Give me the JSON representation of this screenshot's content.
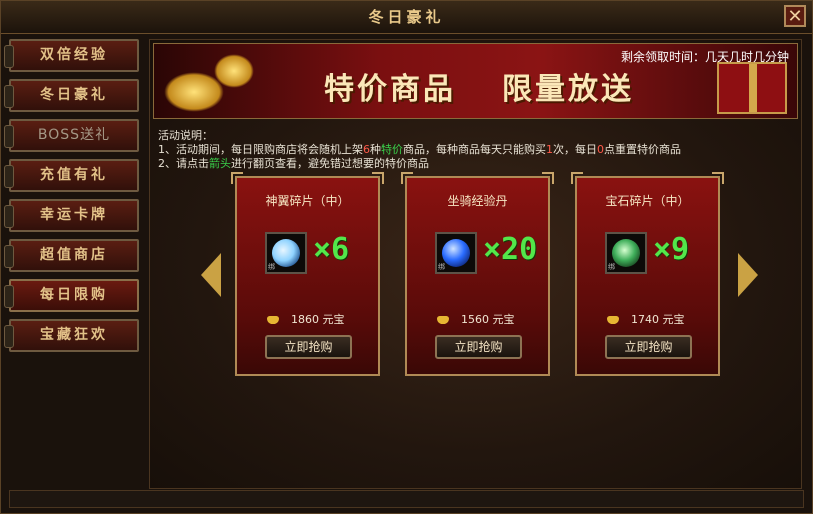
{
  "window": {
    "title": "冬日豪礼",
    "close_label": "✕"
  },
  "sidebar": {
    "tabs": [
      {
        "label": "双倍经验",
        "state": "normal"
      },
      {
        "label": "冬日豪礼",
        "state": "normal"
      },
      {
        "label": "BOSS送礼",
        "state": "disabled"
      },
      {
        "label": "充值有礼",
        "state": "normal"
      },
      {
        "label": "幸运卡牌",
        "state": "normal"
      },
      {
        "label": "超值商店",
        "state": "normal"
      },
      {
        "label": "每日限购",
        "state": "active"
      },
      {
        "label": "宝藏狂欢",
        "state": "normal"
      }
    ]
  },
  "banner": {
    "title_left": "特价商品",
    "title_right": "限量放送",
    "timer_text": "剩余领取时间：几天几时几分钟"
  },
  "description": {
    "heading": "活动说明：",
    "line1_a": "1、活动期间，每日限购商店将会随机上架",
    "line1_num": "6",
    "line1_b": "种",
    "line1_special": "特价",
    "line1_c": "商品，每种商品每天只能购买",
    "line1_once": "1",
    "line1_d": "次，每日",
    "line1_zero": "0",
    "line1_e": "点重置特价商品",
    "line2_a": "2、请点击",
    "line2_arrow": "箭头",
    "line2_b": "进行翻页查看，避免错过想要的特价商品"
  },
  "items": [
    {
      "name": "神翼碎片（中）",
      "quantity": "×6",
      "price": "1860 元宝",
      "buy_label": "立即抢购",
      "lock": "绑",
      "gem_color": "#8fd3ff"
    },
    {
      "name": "坐骑经验丹",
      "quantity": "×20",
      "price": "1560 元宝",
      "buy_label": "立即抢购",
      "lock": "绑",
      "gem_color": "#2a6cff"
    },
    {
      "name": "宝石碎片（中）",
      "quantity": "×9",
      "price": "1740 元宝",
      "buy_label": "立即抢购",
      "lock": "绑",
      "gem_color": "#3fae5a"
    }
  ]
}
